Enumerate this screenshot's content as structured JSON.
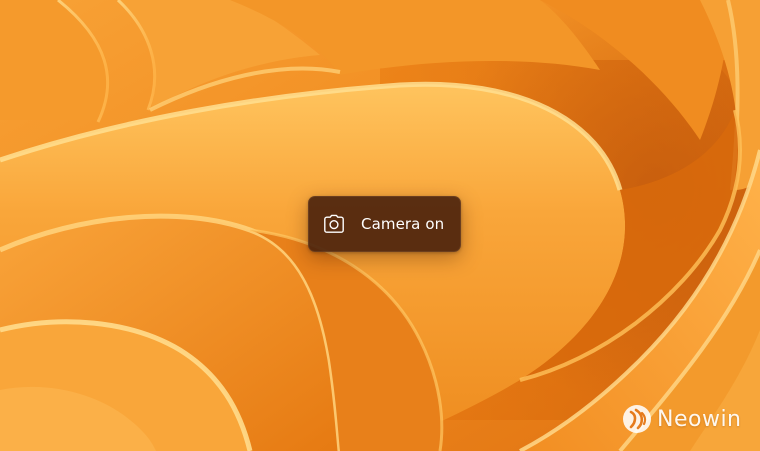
{
  "background": {
    "description_icon": "windows-11-bloom-wallpaper",
    "colors": {
      "base": "#f08a1e",
      "highlight": "#ffc260",
      "shadow": "#c85a08"
    }
  },
  "osd": {
    "icon": "camera-icon",
    "label": "Camera on",
    "background_color": "#48200c"
  },
  "watermark": {
    "text": "Neowin",
    "icon": "neowin-logo-icon"
  }
}
